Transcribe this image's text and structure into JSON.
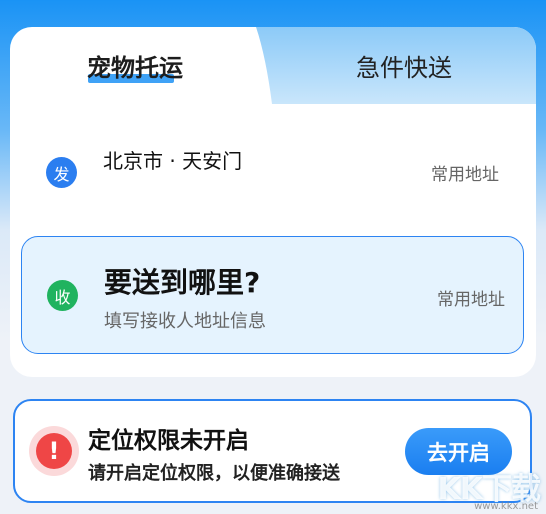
{
  "tabs": [
    {
      "label": "宠物托运",
      "active": true
    },
    {
      "label": "急件快送",
      "active": false
    }
  ],
  "sender": {
    "badge": "发",
    "address": "北京市 · 天安门",
    "common_label": "常用地址"
  },
  "receiver": {
    "badge": "收",
    "title": "要送到哪里?",
    "placeholder": "填写接收人地址信息",
    "common_label": "常用地址"
  },
  "permission": {
    "icon": "!",
    "title": "定位权限未开启",
    "subtitle": "请开启定位权限，以便准确接送",
    "button_label": "去开启"
  },
  "watermark": {
    "logo": "KK下载",
    "url": "www.kkx.net"
  },
  "colors": {
    "primary": "#2d84f2",
    "send_badge": "#2b7ef0",
    "receive_badge": "#20b35f",
    "warning": "#ef4646",
    "receive_bg": "#e5f3fe"
  }
}
